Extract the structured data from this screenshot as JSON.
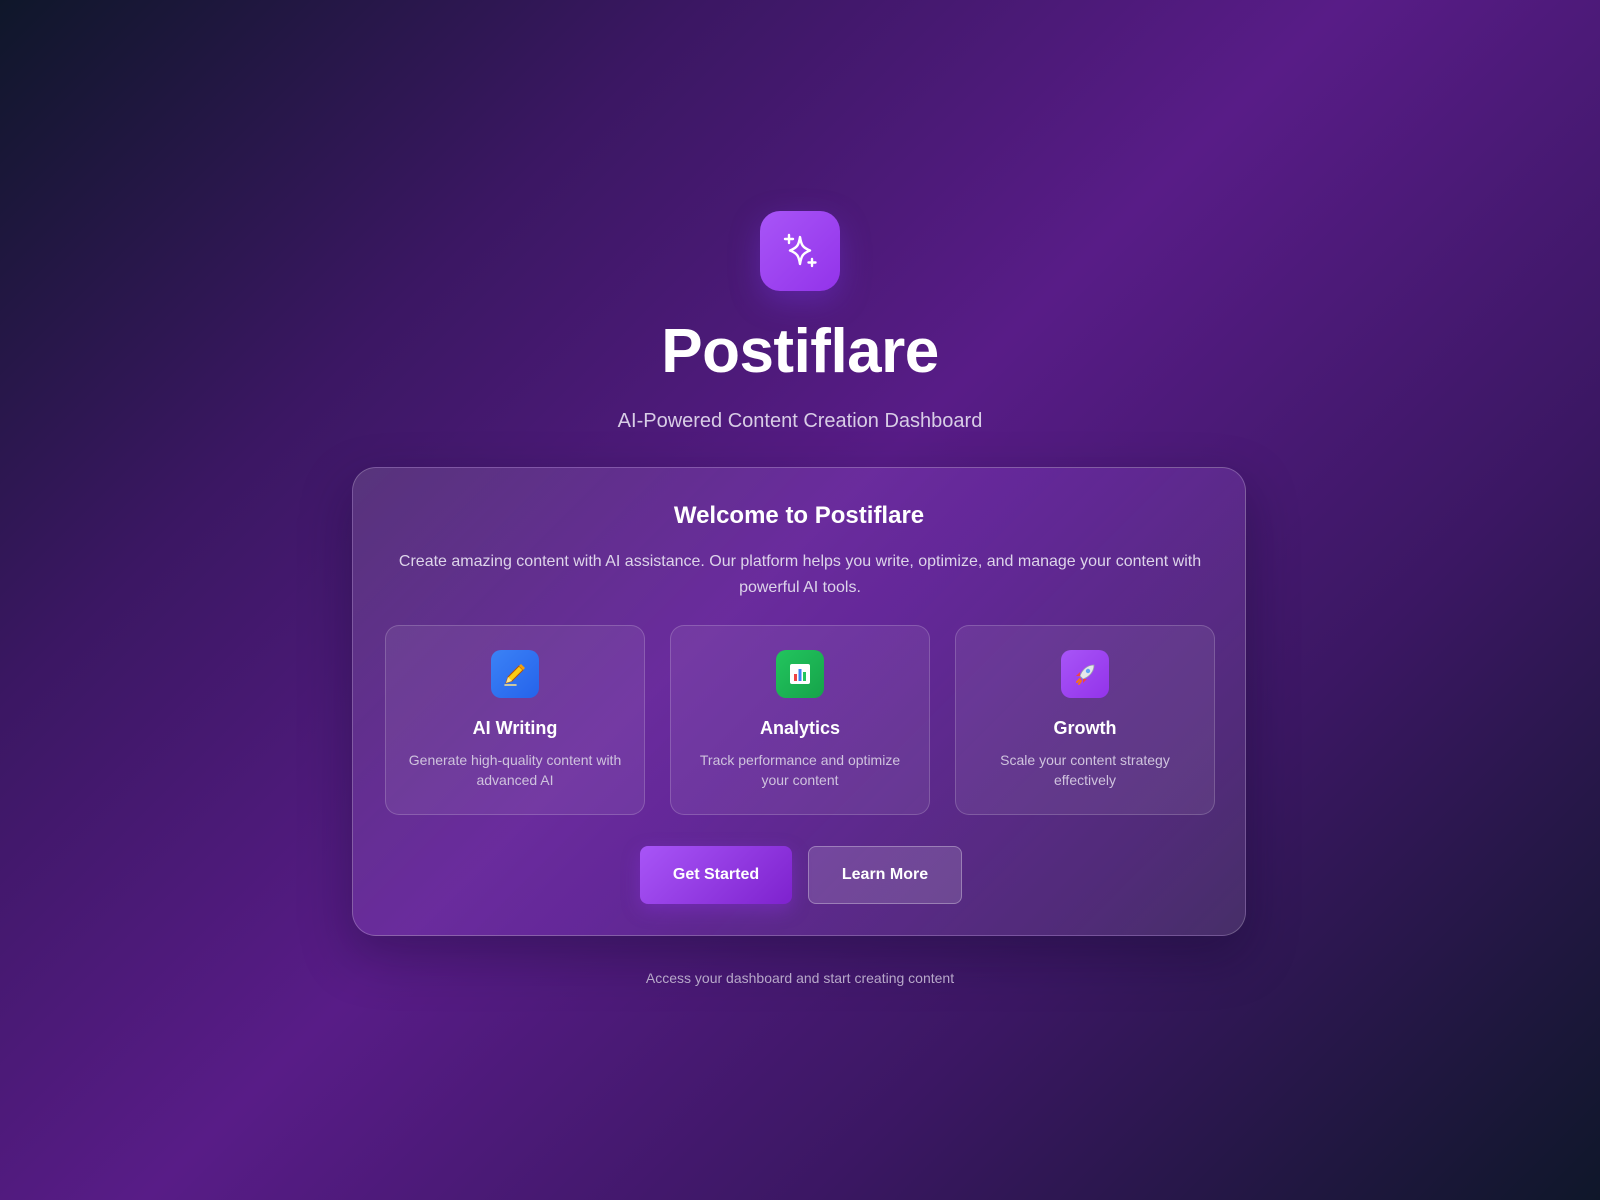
{
  "brand": {
    "name": "Postiflare",
    "tagline": "AI-Powered Content Creation Dashboard",
    "logo_icon": "sparkles-icon"
  },
  "welcome_card": {
    "title": "Welcome to Postiflare",
    "description": "Create amazing content with AI assistance. Our platform helps you write, optimize, and manage your content with powerful AI tools.",
    "features": [
      {
        "icon": "writing-hand-icon",
        "title": "AI Writing",
        "description": "Generate high-quality content with advanced AI",
        "icon_color": "#3b82f6"
      },
      {
        "icon": "bar-chart-icon",
        "title": "Analytics",
        "description": "Track performance and optimize your content",
        "icon_color": "#22c55e"
      },
      {
        "icon": "rocket-icon",
        "title": "Growth",
        "description": "Scale your content strategy effectively",
        "icon_color": "#a855f7"
      }
    ],
    "buttons": {
      "primary_label": "Get Started",
      "secondary_label": "Learn More"
    }
  },
  "footer": {
    "note": "Access your dashboard and start creating content"
  },
  "colors": {
    "accent": "#a855f7",
    "accent_dark": "#7e22ce",
    "background_dark": "#0f172a",
    "background_purple": "#581c87"
  }
}
